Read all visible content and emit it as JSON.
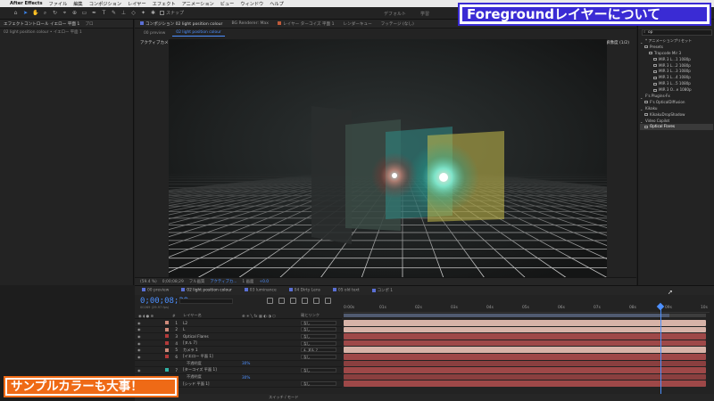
{
  "menubar": {
    "apple": "",
    "app": "After Effects",
    "items": [
      "ファイル",
      "編集",
      "コンポジション",
      "レイヤー",
      "エフェクト",
      "アニメーション",
      "ビュー",
      "ウィンドウ",
      "ヘルプ"
    ]
  },
  "toolbar": {
    "snap_label": "スナップ",
    "workspaces": [
      "デフォルト",
      "学習"
    ]
  },
  "banner_top": "Foregroundレイヤーについて",
  "left_panel": {
    "tab": "エフェクトコントロール イエロー 平面 1",
    "tab2": "プロ",
    "breadcrumb": "02 light position colour • イエロー 平面 1"
  },
  "comp_panel": {
    "tabs": [
      "コンポジション 02 light position colour",
      "BG Renderer: Max",
      "レイヤー ターコイズ 平面 1",
      "レンダーキュー",
      "フッテージ (なし)"
    ],
    "subtabs": [
      "00 preview",
      "02 light position colour"
    ],
    "camera_label": "アクティブカメラ",
    "renderer_label": "レンダラー： クラシック3D",
    "resolution_label": "適応解像度 (1/2)",
    "footer": {
      "zoom": "(59.4 %)",
      "timecode": "0;00;08;29",
      "quality": "フル画質",
      "camera": "アクティブカ...",
      "views": "1 画面",
      "exposure": "+0.0"
    }
  },
  "right_panel": {
    "tabs": [
      "レンダー",
      "クラシック3D"
    ],
    "search_value": "op",
    "tree": [
      {
        "label": "* アニメーションプリセット",
        "indent": 0
      },
      {
        "label": "Presets",
        "indent": 1
      },
      {
        "label": "Trapcode Mir 3",
        "indent": 2
      },
      {
        "label": "MIR 3 L...1 1080p",
        "indent": 3
      },
      {
        "label": "MIR 3 L...2 1080p",
        "indent": 3
      },
      {
        "label": "MIR 3 L...3 1080p",
        "indent": 3
      },
      {
        "label": "MIR 3 L...4 1080p",
        "indent": 3
      },
      {
        "label": "MIR 3 L...5 1080p",
        "indent": 3
      },
      {
        "label": "MIR 3 O...e 1080p",
        "indent": 3
      },
      {
        "label": "F's Plugins-Fx",
        "indent": 0
      },
      {
        "label": "F's OpticalDiffusion",
        "indent": 1
      },
      {
        "label": "Kikaku",
        "indent": 0
      },
      {
        "label": "KikakuDropShadow",
        "indent": 1
      },
      {
        "label": "Video Copilot",
        "indent": 0
      },
      {
        "label": "Optical Flares",
        "indent": 1,
        "selected": true
      }
    ]
  },
  "timeline": {
    "tabs": [
      "00 preview",
      "02 light position colour",
      "03 luminance",
      "04 Dirty Lens",
      "05 old text",
      "コンポ 1"
    ],
    "active_tab_index": 1,
    "timecode": "0;00;08;29",
    "framecode": "00269 (29.97 fps)",
    "col_layer_name": "レイヤー名",
    "col_parent": "親とリンク",
    "ruler": [
      "0:00s",
      "01s",
      "02s",
      "03s",
      "04s",
      "05s",
      "06s",
      "07s",
      "08s",
      "09s",
      "10s"
    ],
    "work_area_fraction": 0.9,
    "cti_fraction": 0.888,
    "layers": [
      {
        "num": "1",
        "name": "L2",
        "color": "#cf8a7a",
        "parent": "なし",
        "bar": "#d7b3a8",
        "sub": false
      },
      {
        "num": "2",
        "name": "L",
        "color": "#cf8a7a",
        "parent": "なし",
        "bar": "#d7b3a8",
        "sub": false
      },
      {
        "num": "3",
        "name": "Optical Flares",
        "color": "#b33a3a",
        "parent": "なし",
        "bar": "#9e4848",
        "sub": false
      },
      {
        "num": "4",
        "name": "[ヌル 7]",
        "color": "#b33a3a",
        "parent": "なし",
        "bar": "#9e4848",
        "sub": false
      },
      {
        "num": "5",
        "name": "カメラ 1",
        "color": "#cf8a7a",
        "parent": "4. ヌル 7",
        "bar": "#d7b3a8",
        "sub": false
      },
      {
        "num": "6",
        "name": "[イエロー 平面 1]",
        "color": "#b33a3a",
        "parent": "なし",
        "bar": "#9e4848",
        "sub": false
      },
      {
        "num": "",
        "name": "不透明度",
        "value": "30%",
        "sub": true,
        "bar": "#8a3f3f"
      },
      {
        "num": "7",
        "name": "[ターコイズ 平面 1]",
        "color": "#2fb3a6",
        "parent": "なし",
        "bar": "#9e4848",
        "sub": false
      },
      {
        "num": "",
        "name": "不透明度",
        "value": "30%",
        "sub": true,
        "bar": "#8a3f3f"
      },
      {
        "num": "8",
        "name": "[シッド 平面 1]",
        "color": "#b33a3a",
        "parent": "なし",
        "bar": "#9e4848",
        "sub": false
      }
    ],
    "footer": "スイッチ / モード"
  },
  "banner_bottom": "サンプルカラーも大事！",
  "colors": {
    "accent_blue": "#4d90ff",
    "banner_purple": "#3a2bd4",
    "banner_orange": "#ef6a16"
  }
}
